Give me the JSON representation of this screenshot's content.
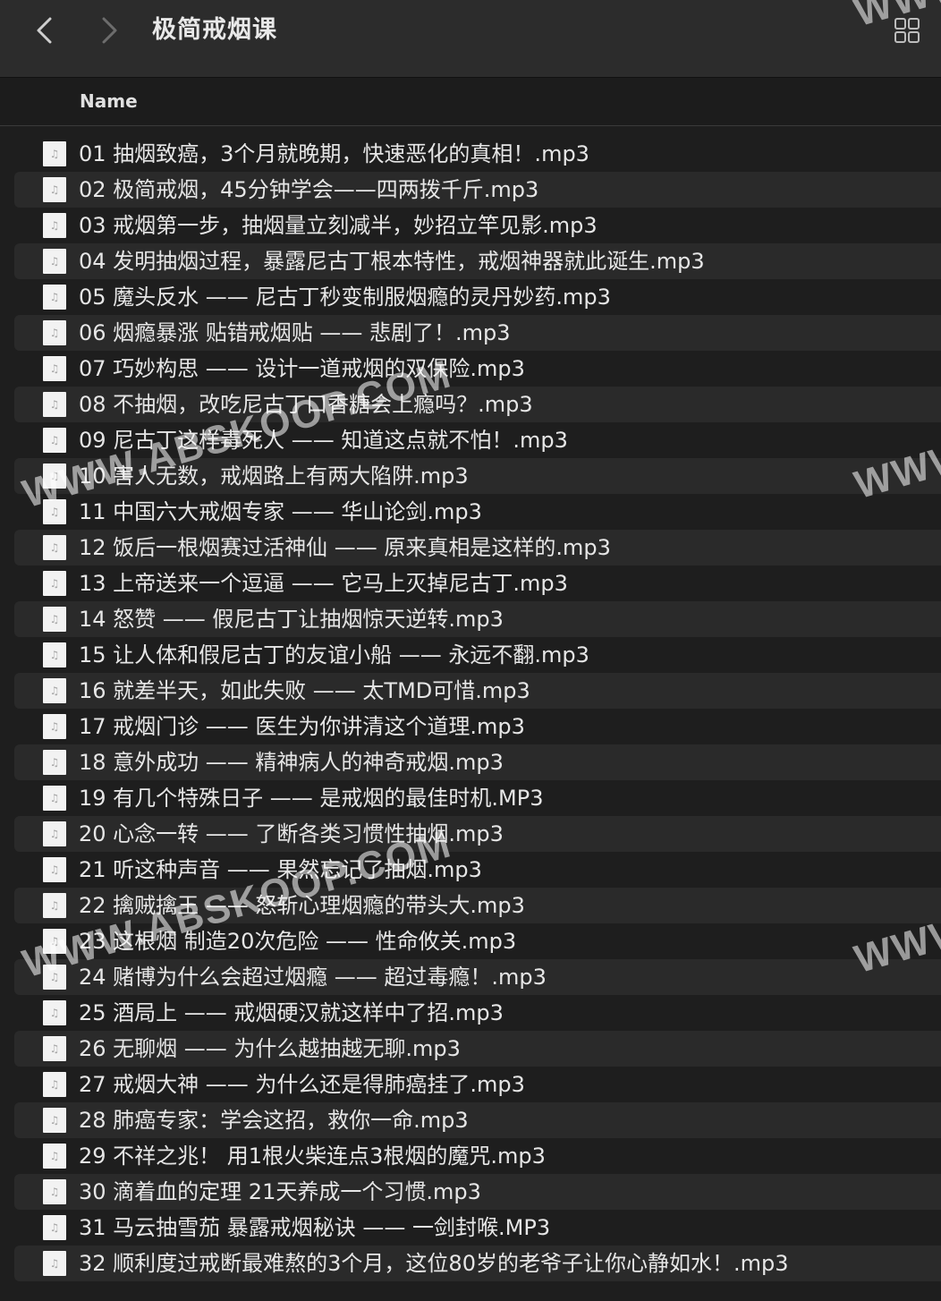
{
  "window": {
    "title": "极简戒烟课"
  },
  "toolbar": {
    "back_icon": "chevron-left-icon",
    "forward_icon": "chevron-right-icon",
    "view_icon": "grid-view-icon"
  },
  "header": {
    "name_label": "Name"
  },
  "files": [
    {
      "name": "01 抽烟致癌，3个月就晚期，快速恶化的真相！.mp3"
    },
    {
      "name": "02 极简戒烟，45分钟学会——四两拨千斤.mp3"
    },
    {
      "name": "03 戒烟第一步，抽烟量立刻减半，妙招立竿见影.mp3"
    },
    {
      "name": "04 发明抽烟过程，暴露尼古丁根本特性，戒烟神器就此诞生.mp3"
    },
    {
      "name": "05 魔头反水 —— 尼古丁秒变制服烟瘾的灵丹妙药.mp3"
    },
    {
      "name": "06 烟瘾暴涨 贴错戒烟贴 —— 悲剧了！.mp3"
    },
    {
      "name": "07 巧妙构思 —— 设计一道戒烟的双保险.mp3"
    },
    {
      "name": "08 不抽烟，改吃尼古丁口香糖会上瘾吗？.mp3"
    },
    {
      "name": "09 尼古丁这样毒死人 —— 知道这点就不怕！.mp3"
    },
    {
      "name": "10 害人无数，戒烟路上有两大陷阱.mp3"
    },
    {
      "name": "11 中国六大戒烟专家 —— 华山论剑.mp3"
    },
    {
      "name": "12 饭后一根烟赛过活神仙 —— 原来真相是这样的.mp3"
    },
    {
      "name": "13 上帝送来一个逗逼 —— 它马上灭掉尼古丁.mp3"
    },
    {
      "name": "14 怒赞 —— 假尼古丁让抽烟惊天逆转.mp3"
    },
    {
      "name": "15 让人体和假尼古丁的友谊小船 —— 永远不翻.mp3"
    },
    {
      "name": "16 就差半天，如此失败 —— 太TMD可惜.mp3"
    },
    {
      "name": "17 戒烟门诊 —— 医生为你讲清这个道理.mp3"
    },
    {
      "name": "18 意外成功 —— 精神病人的神奇戒烟.mp3"
    },
    {
      "name": "19 有几个特殊日子 —— 是戒烟的最佳时机.MP3"
    },
    {
      "name": "20 心念一转 —— 了断各类习惯性抽烟.mp3"
    },
    {
      "name": "21 听这种声音 —— 果然忘记了抽烟.mp3"
    },
    {
      "name": "22 擒贼擒王 —— 怒斩心理烟瘾的带头大.mp3"
    },
    {
      "name": "23 这根烟 制造20次危险 —— 性命攸关.mp3"
    },
    {
      "name": "24 赌博为什么会超过烟瘾 —— 超过毒瘾！.mp3"
    },
    {
      "name": "25 酒局上 —— 戒烟硬汉就这样中了招.mp3"
    },
    {
      "name": "26 无聊烟 —— 为什么越抽越无聊.mp3"
    },
    {
      "name": "27 戒烟大神 —— 为什么还是得肺癌挂了.mp3"
    },
    {
      "name": "28 肺癌专家：学会这招，救你一命.mp3"
    },
    {
      "name": "29 不祥之兆！ 用1根火柴连点3根烟的魔咒.mp3"
    },
    {
      "name": "30 滴着血的定理 21天养成一个习惯.mp3"
    },
    {
      "name": "31 马云抽雪茄 暴露戒烟秘诀 —— 一剑封喉.MP3"
    },
    {
      "name": "32 顺利度过戒断最难熬的3个月，这位80岁的老爷子让你心静如水！.mp3"
    }
  ],
  "file_icon_glyph": "♫",
  "watermarks": [
    {
      "text": "WWW.ABSKOOP.COM"
    },
    {
      "text": "WWW.ABSKOOP.COM"
    },
    {
      "text": "WWW"
    },
    {
      "text": "WWW"
    },
    {
      "text": "WWW"
    }
  ]
}
